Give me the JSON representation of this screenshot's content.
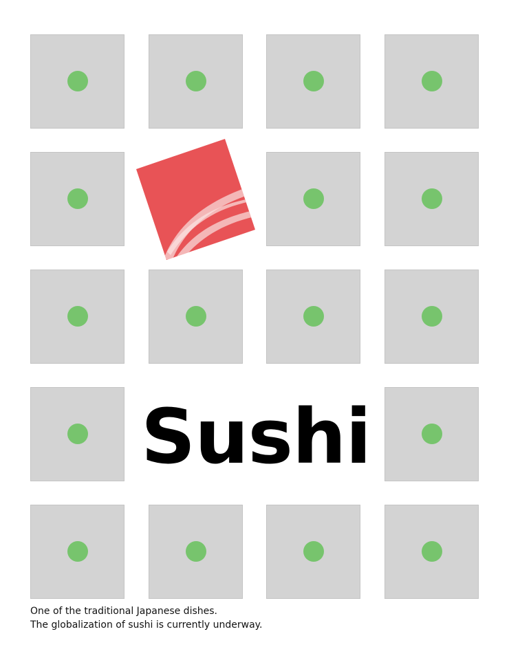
{
  "poster": {
    "title": "Sushi",
    "caption_lines": [
      "One of the traditional Japanese dishes.",
      "The globalization of sushi is currently underway."
    ]
  },
  "colors": {
    "background": "#ffffff",
    "tile": "#d3d3d3",
    "dot": "#77c46d",
    "sushi_red": "#e85356",
    "sushi_stripe": "#f6c9c8",
    "title_text": "#000000"
  },
  "grid": {
    "rows": 5,
    "columns": 4,
    "tile_icon": "green-dot-icon",
    "highlight_icon": "salmon-nigiri-icon"
  }
}
